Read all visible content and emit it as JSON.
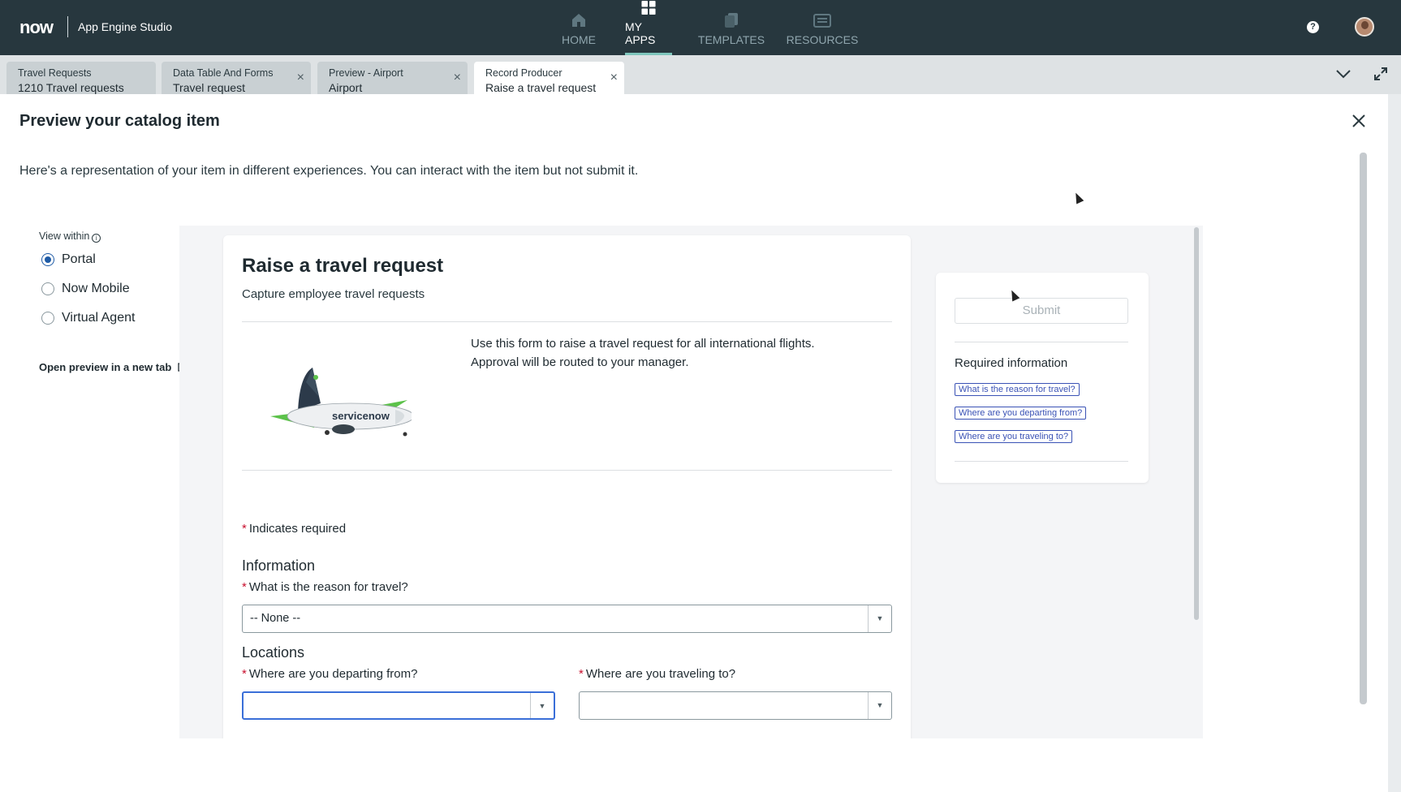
{
  "topbar": {
    "logo": "now",
    "app_name": "App Engine Studio",
    "nav": [
      {
        "label": "HOME",
        "icon": "home-icon"
      },
      {
        "label": "MY APPS",
        "icon": "grid-icon",
        "active": true
      },
      {
        "label": "TEMPLATES",
        "icon": "templates-icon"
      },
      {
        "label": "RESOURCES",
        "icon": "resources-icon"
      }
    ],
    "help": "?"
  },
  "tabs": [
    {
      "title": "Travel Requests",
      "subtitle": "1210 Travel requests",
      "closable": false
    },
    {
      "title": "Data Table And Forms",
      "subtitle": "Travel request",
      "closable": true
    },
    {
      "title": "Preview - Airport",
      "subtitle": "Airport",
      "closable": true
    },
    {
      "title": "Record Producer",
      "subtitle": "Raise a travel request",
      "closable": true,
      "active": true
    }
  ],
  "page": {
    "title": "Preview your catalog item",
    "description": "Here's a representation of your item in different experiences. You can interact with the item but not submit it."
  },
  "view_within": {
    "label": "View within",
    "options": [
      {
        "label": "Portal",
        "selected": true
      },
      {
        "label": "Now Mobile",
        "selected": false
      },
      {
        "label": "Virtual Agent",
        "selected": false
      }
    ],
    "open_preview": "Open preview in a new tab"
  },
  "form": {
    "title": "Raise a travel request",
    "subtitle": "Capture employee travel requests",
    "description_line1": "Use this form to raise a travel request for all international flights.",
    "description_line2": "Approval will be routed to your manager.",
    "required_note": "Indicates required",
    "section_info": "Information",
    "q_reason": "What is the reason for travel?",
    "reason_value": "-- None --",
    "section_locations": "Locations",
    "q_departing": "Where are you departing from?",
    "departing_value": "",
    "q_traveling": "Where are you traveling to?",
    "traveling_value": ""
  },
  "side_panel": {
    "submit_label": "Submit",
    "required_title": "Required information",
    "required_links": [
      "What is the reason for travel?",
      "Where are you departing from?",
      "Where are you traveling to?"
    ]
  },
  "colors": {
    "topbar_bg": "#27373e",
    "accent": "#7ec6bc",
    "link": "#3a52b5",
    "required": "#c8102e",
    "radio_selected": "#1f5ba6"
  }
}
